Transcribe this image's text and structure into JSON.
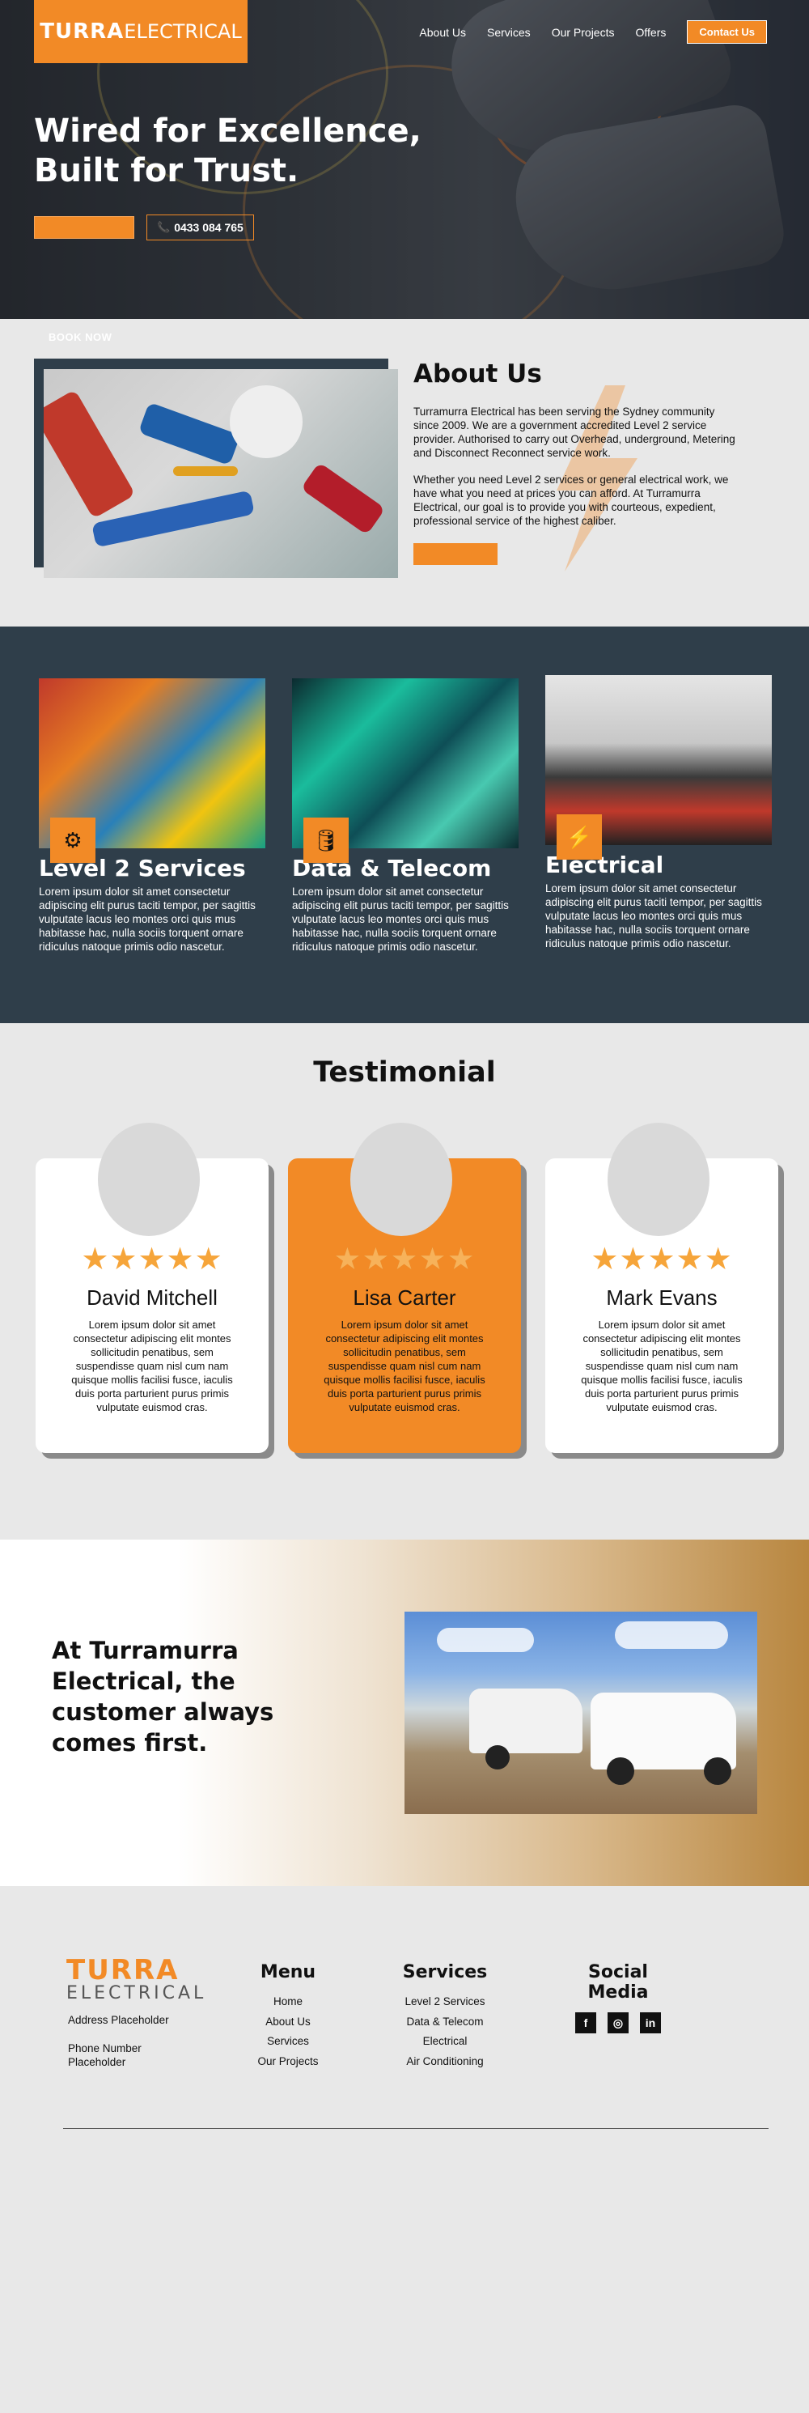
{
  "header": {
    "logo_bold": "TURRA",
    "logo_light": "ELECTRICAL",
    "nav": [
      "About Us",
      "Services",
      "Our Projects",
      "Offers"
    ],
    "cta": "Contact Us"
  },
  "hero": {
    "title_line1": "Wired for Excellence,",
    "title_line2": "Built for Trust.",
    "phone": "0433 084 765",
    "book_now": "BOOK NOW"
  },
  "about": {
    "title": "About Us",
    "para1": "Turramurra Electrical has been serving the Sydney community since 2009. We are a government accredited Level 2 service provider. Authorised to carry out Overhead, underground, Metering and Disconnect Reconnect service work.",
    "para2": "Whether you need Level 2 services or general electrical work, we have what you need at prices you can afford. At Turramurra Electrical, our goal is to provide you with courteous, expedient, professional service of the highest caliber."
  },
  "services": [
    {
      "title": "Level 2 Services",
      "icon": "gear-house-icon",
      "text": "Lorem ipsum dolor sit amet consectetur adipiscing elit purus taciti tempor, per sagittis vulputate lacus leo montes orci quis mus habitasse hac, nulla sociis torquent ornare ridiculus natoque primis odio nascetur."
    },
    {
      "title": "Data & Telecom",
      "icon": "database-icon",
      "text": "Lorem ipsum dolor sit amet consectetur adipiscing elit purus taciti tempor, per sagittis vulputate lacus leo montes orci quis mus habitasse hac, nulla sociis torquent ornare ridiculus natoque primis odio nascetur."
    },
    {
      "title": "Electrical",
      "icon": "battery-bolt-icon",
      "text": "Lorem ipsum dolor sit amet consectetur adipiscing elit purus taciti tempor, per sagittis vulputate lacus leo montes orci quis mus habitasse hac, nulla sociis torquent ornare ridiculus natoque primis odio nascetur."
    }
  ],
  "testimonials": {
    "title": "Testimonial",
    "items": [
      {
        "name": "David Mitchell",
        "stars": "★★★★★",
        "rating": 5,
        "quote": "Lorem ipsum dolor sit amet consectetur adipiscing elit montes sollicitudin penatibus, sem suspendisse quam nisl cum nam quisque mollis facilisi fusce, iaculis duis porta parturient purus primis vulputate euismod cras."
      },
      {
        "name": "Lisa Carter",
        "stars": "★★★★★",
        "rating": 5,
        "quote": "Lorem ipsum dolor sit amet consectetur adipiscing elit montes sollicitudin penatibus, sem suspendisse quam nisl cum nam quisque mollis facilisi fusce, iaculis duis porta parturient purus primis vulputate euismod cras."
      },
      {
        "name": "Mark Evans",
        "stars": "★★★★★",
        "rating": 5,
        "quote": "Lorem ipsum dolor sit amet consectetur adipiscing elit montes sollicitudin penatibus, sem suspendisse quam nisl cum nam quisque mollis facilisi fusce, iaculis duis porta parturient purus primis vulputate euismod cras."
      }
    ]
  },
  "customer_first": {
    "line1": "At Turramurra",
    "line2": "Electrical, the",
    "line3": "customer always",
    "line4": "comes first."
  },
  "footer": {
    "logo_top": "TURRA",
    "logo_bottom": "ELECTRICAL",
    "address": "Address Placeholder",
    "phone": "Phone Number Placeholder",
    "menu_title": "Menu",
    "menu": [
      "Home",
      "About Us",
      "Services",
      "Our Projects"
    ],
    "services_title": "Services",
    "services": [
      "Level 2 Services",
      "Data & Telecom",
      "Electrical",
      "Air Conditioning"
    ],
    "social_title": "Social Media",
    "social": [
      {
        "icon": "facebook-icon",
        "glyph": "f"
      },
      {
        "icon": "instagram-icon",
        "glyph": "◎"
      },
      {
        "icon": "linkedin-icon",
        "glyph": "in"
      }
    ]
  },
  "colors": {
    "accent": "#f28a26",
    "dark": "#2f3e4a",
    "bg": "#e8e8e8"
  }
}
